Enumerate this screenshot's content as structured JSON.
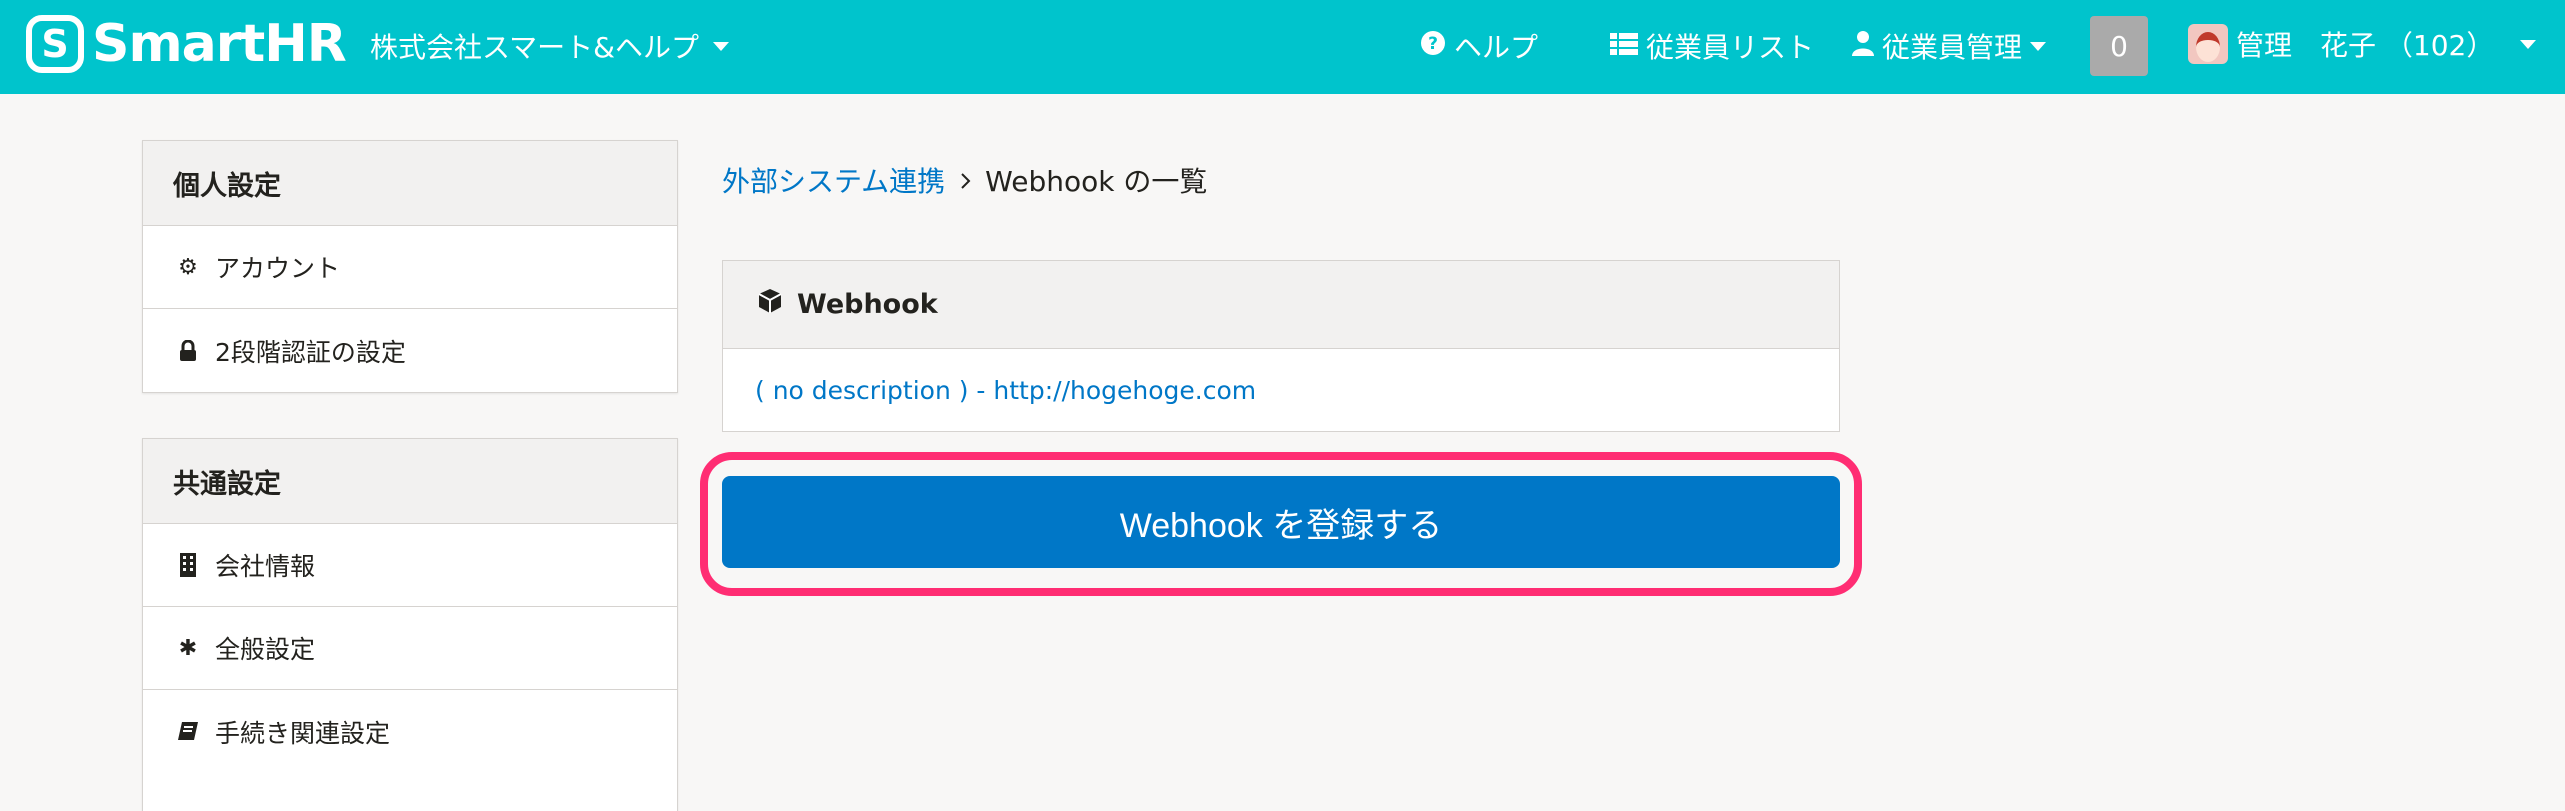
{
  "header": {
    "logo_mark": "S",
    "logo_text": "SmartHR",
    "company": "株式会社スマート&ヘルプ",
    "nav": {
      "help": "ヘルプ",
      "employee_list": "従業員リスト",
      "employee_mgmt": "従業員管理"
    },
    "notification_count": "0",
    "user_name": "管理　花子 （102）",
    "accent_color": "#00c4cc"
  },
  "sidebar": {
    "personal": {
      "title": "個人設定",
      "items": [
        {
          "label": "アカウント",
          "icon": "gear-icon"
        },
        {
          "label": "2段階認証の設定",
          "icon": "lock-icon"
        }
      ]
    },
    "common": {
      "title": "共通設定",
      "items": [
        {
          "label": "会社情報",
          "icon": "building-icon"
        },
        {
          "label": "全般設定",
          "icon": "asterisk-icon"
        },
        {
          "label": "手続き関連設定",
          "icon": "book-icon"
        }
      ]
    }
  },
  "breadcrumb": {
    "parent": "外部システム連携",
    "current": "Webhook の一覧"
  },
  "webhook_panel": {
    "title": "Webhook",
    "icon": "cube-icon",
    "rows": [
      {
        "label": "( no description ) - http://hogehoge.com"
      }
    ]
  },
  "register_button": {
    "label": "Webhook を登録する",
    "color": "#0077c7"
  },
  "highlight_color": "#ff2d73"
}
